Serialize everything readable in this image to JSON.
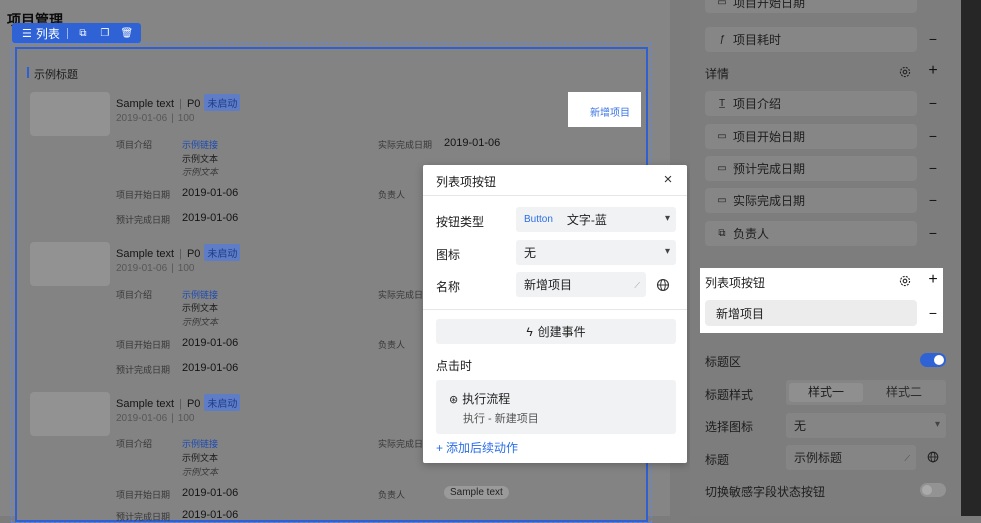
{
  "page_title": "项目管理",
  "toolbar": {
    "list_label": "列表"
  },
  "list": {
    "title": "示例标题",
    "add_button": "新增项目",
    "items": [
      {
        "title": "Sample text",
        "priority": "P0",
        "status": "未启动",
        "date": "2019-01-06",
        "count": "100",
        "intro_label": "项目介绍",
        "link": "示例链接",
        "text": "示例文本",
        "italic": "示例文本",
        "actual_label": "实际完成日期",
        "actual_value": "2019-01-06",
        "start_label": "项目开始日期",
        "start_value": "2019-01-06",
        "owner_label": "负责人",
        "plan_label": "预计完成日期",
        "plan_value": "2019-01-06"
      },
      {
        "title": "Sample text",
        "priority": "P0",
        "status": "未启动",
        "date": "2019-01-06",
        "count": "100",
        "intro_label": "项目介绍",
        "link": "示例链接",
        "text": "示例文本",
        "italic": "示例文本",
        "actual_label": "实际完成日",
        "start_label": "项目开始日期",
        "start_value": "2019-01-06",
        "owner_label": "负责人",
        "plan_label": "预计完成日期",
        "plan_value": "2019-01-06"
      },
      {
        "title": "Sample text",
        "priority": "P0",
        "status": "未启动",
        "date": "2019-01-06",
        "count": "100",
        "intro_label": "项目介绍",
        "link": "示例链接",
        "text": "示例文本",
        "italic": "示例文本",
        "actual_label": "实际完成日",
        "start_label": "项目开始日期",
        "start_value": "2019-01-06",
        "owner_label": "负责人",
        "owner_value": "Sample text",
        "plan_label": "预计完成日期",
        "plan_value": "2019-01-06"
      }
    ]
  },
  "modal": {
    "title": "列表项按钮",
    "close": "×",
    "button_type_label": "按钮类型",
    "button_type_tag": "Button",
    "button_type_value": "文字-蓝",
    "icon_label": "图标",
    "icon_value": "无",
    "name_label": "名称",
    "name_value": "新增项目",
    "create_event": "创建事件",
    "on_click_label": "点击时",
    "flow_title": "执行流程",
    "flow_sub": "执行 - 新建项目",
    "add_follow": "添加后续动作"
  },
  "panel": {
    "top_item": "项目开始日期",
    "duration_item": "项目耗时",
    "details_label": "详情",
    "detail_items": [
      "项目介绍",
      "项目开始日期",
      "预计完成日期",
      "实际完成日期",
      "负责人"
    ],
    "list_button_label": "列表项按钮",
    "list_button_item": "新增项目",
    "title_area_label": "标题区",
    "title_style_label": "标题样式",
    "style_one": "样式一",
    "style_two": "样式二",
    "select_icon_label": "选择图标",
    "select_icon_value": "无",
    "title_label": "标题",
    "title_value": "示例标题",
    "sensitive_label": "切换敏感字段状态按钮",
    "title_area_on": true,
    "sensitive_on": false
  },
  "colors": {
    "accent": "#2f63d5",
    "link": "#2b6ee8"
  }
}
